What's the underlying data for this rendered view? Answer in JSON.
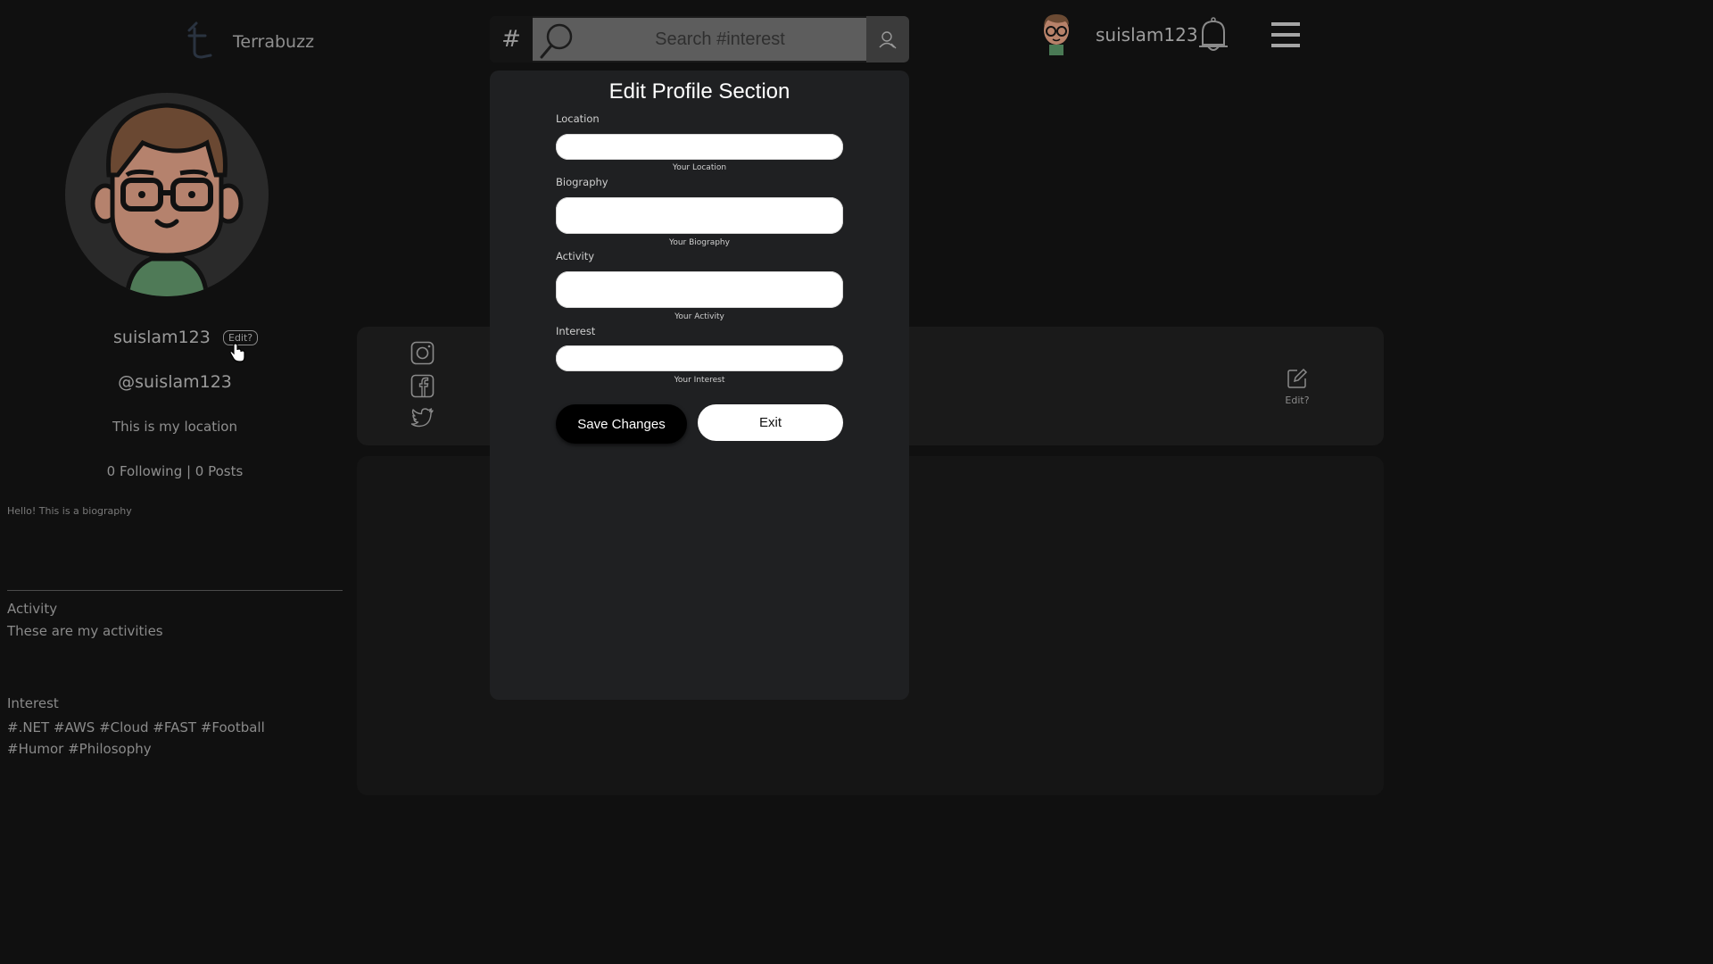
{
  "header": {
    "brand": "Terrabuzz",
    "hash_symbol": "#",
    "search_placeholder": "Search #interest",
    "username": "suislam123"
  },
  "profile": {
    "username": "suislam123",
    "edit_label": "Edit?",
    "handle": "@suislam123",
    "location": "This is my location",
    "stats": "0 Following | 0 Posts",
    "biography": "Hello! This is a biography",
    "activity_heading": "Activity",
    "activity_text": "These are my activities",
    "interest_heading": "Interest",
    "interest_tags": "#.NET #AWS #Cloud #FAST #Football #Humor #Philosophy"
  },
  "social": {
    "icons": [
      "instagram-icon",
      "facebook-icon",
      "twitter-icon"
    ],
    "edit_label": "Edit?"
  },
  "modal": {
    "title": "Edit Profile Section",
    "location_label": "Location",
    "location_hint": "Your Location",
    "location_value": "",
    "biography_label": "Biography",
    "biography_hint": "Your Biography",
    "biography_value": "",
    "activity_label": "Activity",
    "activity_hint": "Your Activity",
    "activity_value": "",
    "interest_label": "Interest",
    "interest_hint": "Your Interest",
    "interest_value": "",
    "save_label": "Save Changes",
    "exit_label": "Exit"
  },
  "colors": {
    "background": "#101010",
    "modal_bg": "#1f2022",
    "panel_bg": "#1a1a1a",
    "primary_button": "#000000",
    "secondary_button": "#ffffff"
  }
}
